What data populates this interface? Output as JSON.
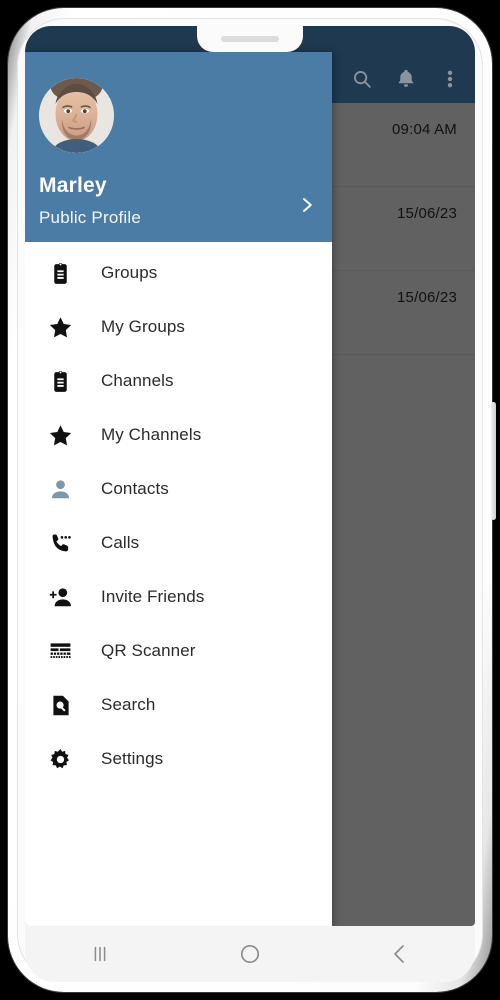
{
  "app": {
    "accent_blue": "#4a7ca6",
    "header_navy": "#1e3950",
    "scrim_color": "rgba(0,0,0,0.62)"
  },
  "appbar": {
    "actions": [
      {
        "name": "search-icon",
        "label": "Search"
      },
      {
        "name": "notifications-icon",
        "label": "Notifications"
      },
      {
        "name": "overflow-menu-icon",
        "label": "More options"
      }
    ]
  },
  "drawer": {
    "profile": {
      "name": "Marley",
      "subtitle": "Public Profile",
      "chevron": "chevron-right-icon",
      "avatar_alt": "Marley profile photo"
    },
    "menu": [
      {
        "icon": "clipboard-icon",
        "label": "Groups",
        "tone": "dark"
      },
      {
        "icon": "star-icon",
        "label": "My Groups",
        "tone": "dark"
      },
      {
        "icon": "clipboard-icon",
        "label": "Channels",
        "tone": "dark"
      },
      {
        "icon": "star-icon",
        "label": "My Channels",
        "tone": "dark"
      },
      {
        "icon": "person-icon",
        "label": "Contacts",
        "tone": "muted"
      },
      {
        "icon": "phone-call-icon",
        "label": "Calls",
        "tone": "dark"
      },
      {
        "icon": "person-add-icon",
        "label": "Invite Friends",
        "tone": "dark"
      },
      {
        "icon": "qr-scanner-icon",
        "label": "QR Scanner",
        "tone": "dark"
      },
      {
        "icon": "document-search-icon",
        "label": "Search",
        "tone": "dark"
      },
      {
        "icon": "gear-icon",
        "label": "Settings",
        "tone": "dark"
      }
    ]
  },
  "chat_list": {
    "rows": [
      {
        "time": "09:04 AM"
      },
      {
        "time": "15/06/23"
      },
      {
        "time": "15/06/23"
      }
    ]
  },
  "system_nav": {
    "buttons": [
      {
        "name": "recents-button",
        "label": "Recents"
      },
      {
        "name": "home-button",
        "label": "Home"
      },
      {
        "name": "back-button",
        "label": "Back"
      }
    ]
  }
}
